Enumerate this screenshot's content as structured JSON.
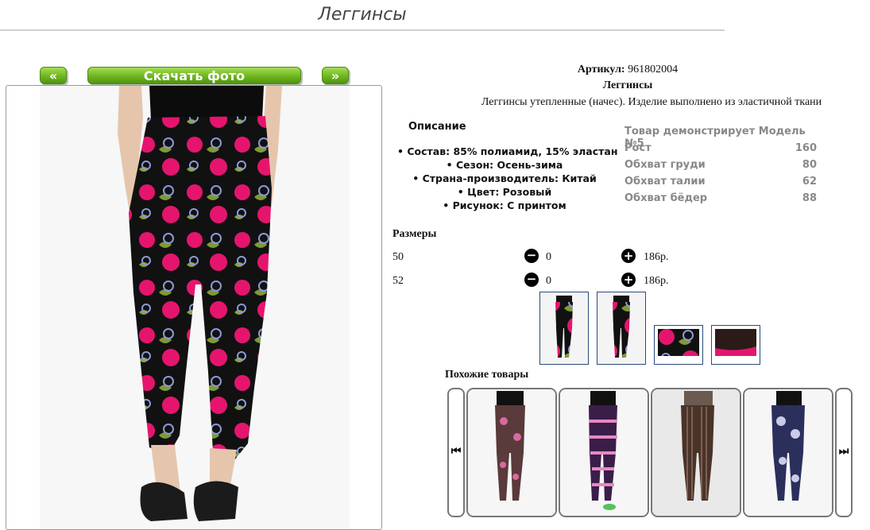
{
  "page": {
    "title": "Леггинсы"
  },
  "photo_nav": {
    "prev": "«",
    "download": "Скачать фото",
    "next": "»"
  },
  "product": {
    "sku_label": "Артикул:",
    "sku_value": "961802004",
    "name": "Леггинсы",
    "description": "Леггинсы утепленные (начес). Изделие выполнено из эластичной ткани"
  },
  "details": {
    "heading": "Описание",
    "items": [
      "• Состав: 85% полиамид, 15% эластан",
      "• Сезон: Осень-зима",
      "• Страна-производитель: Китай",
      "• Цвет: Розовый",
      "• Рисунок: С принтом"
    ]
  },
  "model": {
    "caption": "Товар демонстрирует Модель №5",
    "rows": [
      {
        "label": "Рост",
        "value": "160"
      },
      {
        "label": "Обхват груди",
        "value": "80"
      },
      {
        "label": "Обхват талии",
        "value": "62"
      },
      {
        "label": "Обхват бёдер",
        "value": "88"
      }
    ]
  },
  "sizes": {
    "heading": "Размеры",
    "minus_icon": "minus-circle-icon",
    "plus_icon": "plus-circle-icon",
    "rows": [
      {
        "size": "50",
        "qty": "0",
        "price": "186р."
      },
      {
        "size": "52",
        "qty": "0",
        "price": "186р."
      }
    ]
  },
  "similar": {
    "heading": "Похожие товары",
    "prev_icon": "skip-back-icon",
    "next_icon": "skip-forward-icon"
  },
  "colors": {
    "button_green": "#6fb51f",
    "pattern_pink": "#e5156e",
    "pattern_black": "#111111",
    "thumb_border": "#2a4a7a"
  }
}
